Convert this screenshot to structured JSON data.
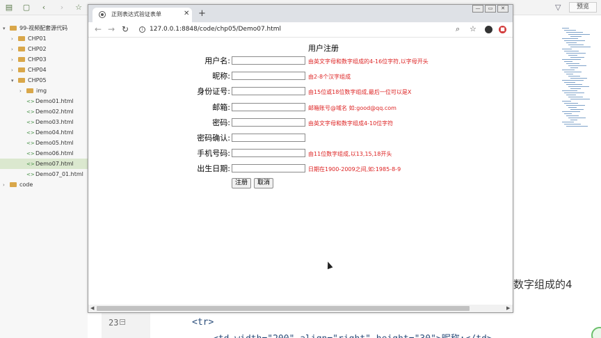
{
  "ide": {
    "preview_label": "预览",
    "tree": [
      {
        "label": "99-视频配套源代码",
        "level": 0,
        "type": "folder",
        "open": true
      },
      {
        "label": "CHP01",
        "level": 1,
        "type": "folder",
        "open": false
      },
      {
        "label": "CHP02",
        "level": 1,
        "type": "folder",
        "open": false
      },
      {
        "label": "CHP03",
        "level": 1,
        "type": "folder",
        "open": false
      },
      {
        "label": "CHP04",
        "level": 1,
        "type": "folder",
        "open": false
      },
      {
        "label": "CHP05",
        "level": 1,
        "type": "folder",
        "open": true
      },
      {
        "label": "img",
        "level": 2,
        "type": "folder",
        "open": false
      },
      {
        "label": "Demo01.html",
        "level": 2,
        "type": "file"
      },
      {
        "label": "Demo02.html",
        "level": 2,
        "type": "file"
      },
      {
        "label": "Demo03.html",
        "level": 2,
        "type": "file"
      },
      {
        "label": "Demo04.html",
        "level": 2,
        "type": "file"
      },
      {
        "label": "Demo05.html",
        "level": 2,
        "type": "file"
      },
      {
        "label": "Demo06.html",
        "level": 2,
        "type": "file"
      },
      {
        "label": "Demo07.html",
        "level": 2,
        "type": "file",
        "selected": true
      },
      {
        "label": "Demo07_01.html",
        "level": 2,
        "type": "file"
      },
      {
        "label": "code",
        "level": 0,
        "type": "folder",
        "open": false
      }
    ],
    "line_number": "23",
    "code_line_1": "<tr>",
    "code_line_2": "<td width=\"200\" align=\"right\" height=\"30\">昵称:</td>",
    "background_text": "数字组成的4"
  },
  "browser": {
    "tab_title": "正则表达式验证表单",
    "url": "127.0.0.1:8848/code/chp05/Demo07.html"
  },
  "form": {
    "title": "用户注册",
    "fields": [
      {
        "label": "用户名:",
        "hint": "由英文字母和数字组成的4-16位字符,以字母开头",
        "value": ""
      },
      {
        "label": "昵称:",
        "hint": "由2-8个汉字组成",
        "value": ""
      },
      {
        "label": "身份证号:",
        "hint": "由15位或18位数字组成,最后一位可以是X",
        "value": ""
      },
      {
        "label": "邮箱:",
        "hint": "邮箱账号@域名 如:good@qq.com",
        "value": ""
      },
      {
        "label": "密码:",
        "hint": "由英文字母和数字组成4-10位字符",
        "value": ""
      },
      {
        "label": "密码确认:",
        "hint": "",
        "value": ""
      },
      {
        "label": "手机号码:",
        "hint": "由11位数字组成,以13,15,18开头",
        "value": ""
      },
      {
        "label": "出生日期:",
        "hint": "日期在1900-2009之间,如:1985-8-9",
        "value": ""
      }
    ],
    "submit_label": "注册",
    "cancel_label": "取消"
  },
  "colors": {
    "hint": "#dd2222",
    "selected_tree_item": "#dbe8cf",
    "tab_bar": "#dee1e6"
  }
}
